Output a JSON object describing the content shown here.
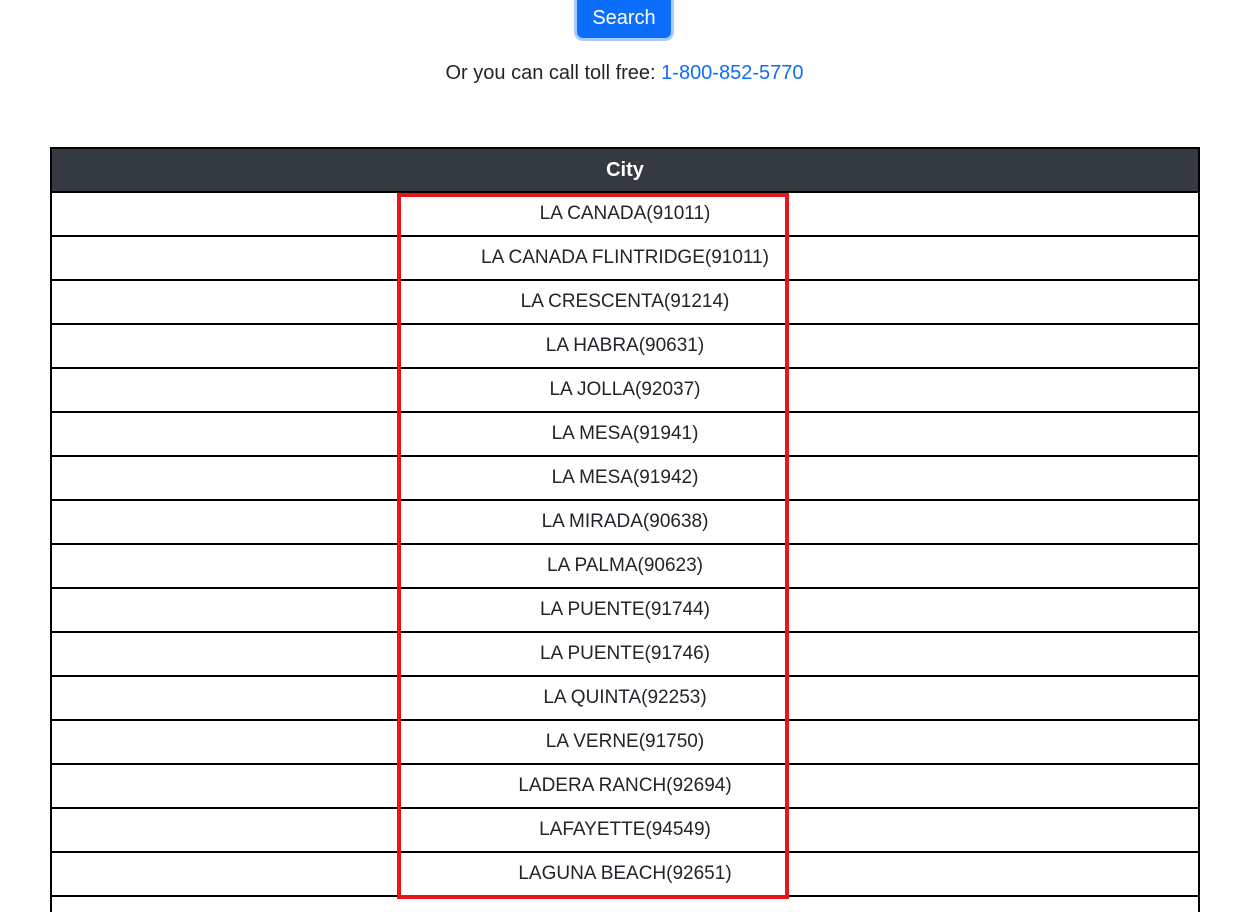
{
  "search": {
    "button_label": "Search"
  },
  "tollfree": {
    "prefix": "Or you can call toll free: ",
    "phone": "1-800-852-5770"
  },
  "table": {
    "header": "City",
    "rows": [
      "LA CANADA(91011)",
      "LA CANADA FLINTRIDGE(91011)",
      "LA CRESCENTA(91214)",
      "LA HABRA(90631)",
      "LA JOLLA(92037)",
      "LA MESA(91941)",
      "LA MESA(91942)",
      "LA MIRADA(90638)",
      "LA PALMA(90623)",
      "LA PUENTE(91744)",
      "LA PUENTE(91746)",
      "LA QUINTA(92253)",
      "LA VERNE(91750)",
      "LADERA RANCH(92694)",
      "LAFAYETTE(94549)",
      "LAGUNA BEACH(92651)",
      ""
    ]
  },
  "colors": {
    "button_bg": "#0d6efd",
    "link": "#0d6efd",
    "header_bg": "#343a40",
    "highlight_border": "#e8141a"
  }
}
